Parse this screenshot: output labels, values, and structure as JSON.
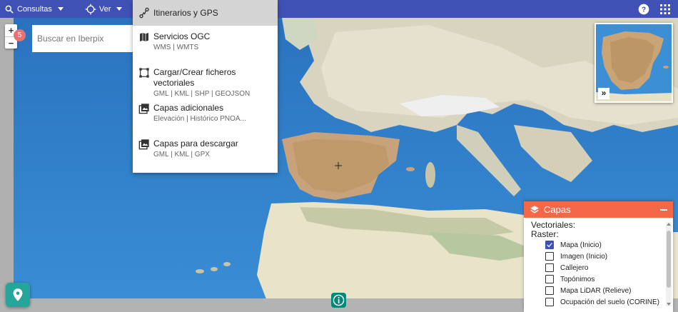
{
  "topbar": {
    "consultas_label": "Consultas",
    "ver_label": "Ver"
  },
  "zoom": {
    "in_label": "+",
    "out_label": "−"
  },
  "badge": {
    "count": "5"
  },
  "search": {
    "placeholder": "Buscar en Iberpix",
    "value": ""
  },
  "menu": {
    "items": [
      {
        "title": "Itinerarios y GPS",
        "subtitle": "",
        "icon": "route-icon"
      },
      {
        "title": "Servicios OGC",
        "subtitle": "WMS | WMTS",
        "icon": "map-icon"
      },
      {
        "title": "Cargar/Crear ficheros vectoriales",
        "subtitle": "GML | KML | SHP | GEOJSON",
        "icon": "vector-polygon-icon"
      },
      {
        "title": "Capas adicionales",
        "subtitle": "Elevación | Histórico PNOA...",
        "icon": "image-layers-icon"
      },
      {
        "title": "Capas para descargar",
        "subtitle": "GML | KML | GPX",
        "icon": "image-layers-icon"
      }
    ]
  },
  "overview": {
    "expand_label": "»"
  },
  "layers": {
    "title": "Capas",
    "vectoriales_label": "Vectoriales:",
    "raster_label": "Raster:",
    "items": [
      {
        "label": "Mapa (Inicio)",
        "checked": true
      },
      {
        "label": "Imagen (Inicio)",
        "checked": false
      },
      {
        "label": "Callejero",
        "checked": false
      },
      {
        "label": "Topónimos",
        "checked": false
      },
      {
        "label": "Mapa LiDAR (Relieve)",
        "checked": false
      },
      {
        "label": "Ocupación del suelo (CORINE)",
        "checked": false
      }
    ]
  },
  "colors": {
    "topbar": "#3f51b5",
    "layers_header": "#f4684a",
    "fab": "#26a69a",
    "sea": "#2f7fc6"
  }
}
